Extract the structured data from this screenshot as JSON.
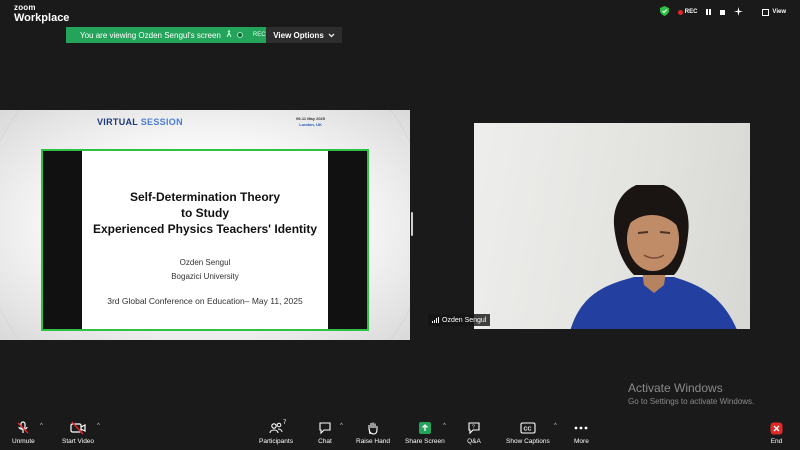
{
  "app": {
    "brand_line1": "zoom",
    "brand_line2": "Workplace"
  },
  "banner": {
    "viewing_text": "You are viewing  Ozden Sengul's screen",
    "rec_label": "REC",
    "view_options": "View Options"
  },
  "top_right": {
    "rec_label": "REC",
    "view_label": "View"
  },
  "shared_slide": {
    "header_virtual": "VIRTUAL",
    "header_session": "SESSION",
    "date": "09-11 May 2025",
    "city": "London, UK",
    "title_lines": [
      "Self-Determination Theory",
      "to Study",
      "Experienced Physics Teachers' Identity"
    ],
    "author": "Ozden Sengul",
    "university": "Bogazici University",
    "conference": "3rd Global Conference on Education– May 11, 2025"
  },
  "participant": {
    "name": "Ozden Sengul"
  },
  "watermark": {
    "title": "Activate Windows",
    "subtitle": "Go to Settings to activate Windows."
  },
  "toolbar": {
    "unmute": "Unmute",
    "start_video": "Start Video",
    "participants": "Participants",
    "participants_count": "7",
    "chat": "Chat",
    "raise_hand": "Raise Hand",
    "share_screen": "Share Screen",
    "qa": "Q&A",
    "show_captions": "Show Captions",
    "more": "More",
    "end": "End"
  },
  "colors": {
    "share_green": "#24a35a",
    "slide_border": "#2fc145",
    "end_red": "#e02828",
    "mute_red": "#e02828"
  }
}
